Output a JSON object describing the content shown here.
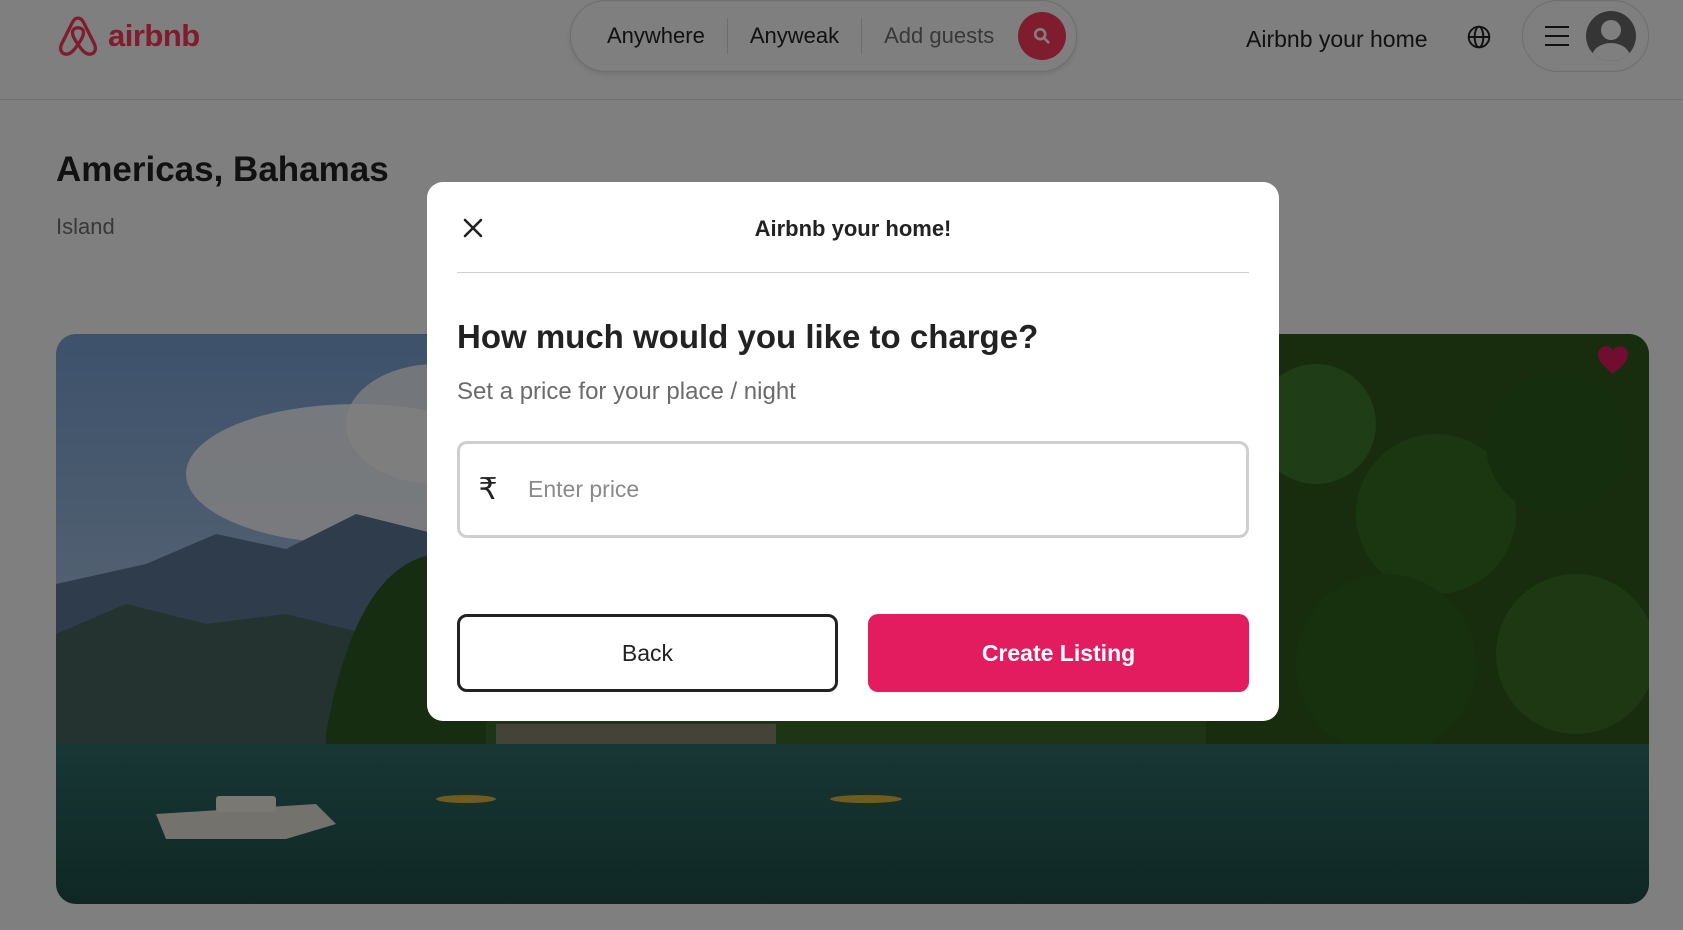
{
  "header": {
    "logo_text": "airbnb",
    "search": {
      "where": "Anywhere",
      "when": "Anyweak",
      "guests": "Add guests"
    },
    "host_link": "Airbnb your home"
  },
  "listing": {
    "title": "Americas, Bahamas",
    "subtitle": "Island"
  },
  "modal": {
    "title": "Airbnb your home!",
    "heading": "How much would you like to charge?",
    "subheading": "Set a price for your place / night",
    "currency_symbol": "₹",
    "price_placeholder": "Enter price",
    "price_value": "",
    "back_label": "Back",
    "create_label": "Create Listing"
  },
  "colors": {
    "brand": "#ff385c",
    "create_button": "#e31c5f"
  },
  "icons": [
    "airbnb-logo-icon",
    "search-icon",
    "globe-icon",
    "hamburger-icon",
    "user-avatar-icon",
    "heart-icon",
    "close-icon"
  ]
}
